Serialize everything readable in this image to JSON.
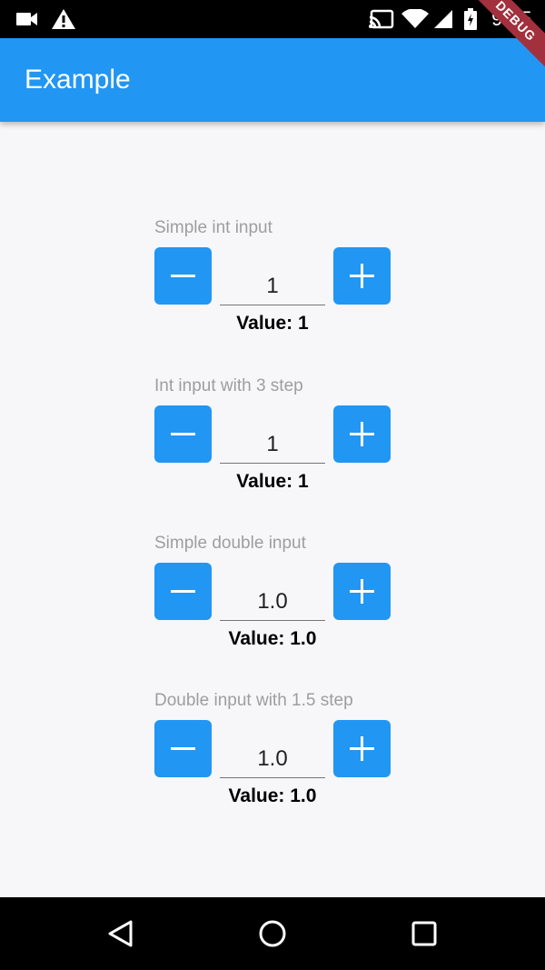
{
  "status_bar": {
    "time": "9:05",
    "left_icons": [
      "video-camera-icon",
      "warning-icon"
    ],
    "right_icons": [
      "cast-icon",
      "wifi-icon",
      "cell-signal-icon",
      "battery-icon"
    ]
  },
  "debug_banner": "DEBUG",
  "app_bar": {
    "title": "Example",
    "color": "#2196f3"
  },
  "inputs": [
    {
      "label": "Simple int input",
      "value": "1",
      "result": "Value: 1"
    },
    {
      "label": "Int input with 3 step",
      "value": "1",
      "result": "Value: 1"
    },
    {
      "label": "Simple double input",
      "value": "1.0",
      "result": "Value: 1.0"
    },
    {
      "label": "Double input with 1.5 step",
      "value": "1.0",
      "result": "Value: 1.0"
    }
  ],
  "navigation": {
    "icons": [
      "back-triangle-icon",
      "home-circle-icon",
      "recents-square-icon"
    ]
  }
}
